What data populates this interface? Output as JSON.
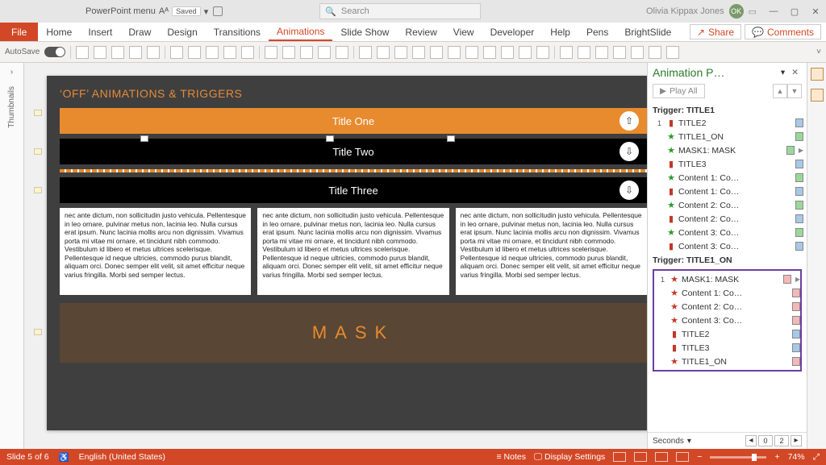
{
  "titlebar": {
    "doc_name": "PowerPoint menu",
    "saved_state": "Saved",
    "search_placeholder": "Search",
    "user_name": "Olivia Kippax Jones",
    "user_initials": "OK"
  },
  "tabs": {
    "file": "File",
    "items": [
      "Home",
      "Insert",
      "Draw",
      "Design",
      "Transitions",
      "Animations",
      "Slide Show",
      "Review",
      "View",
      "Developer",
      "Help",
      "Pens",
      "BrightSlide"
    ],
    "active": "Animations",
    "share": "Share",
    "comments": "Comments"
  },
  "toolbar": {
    "autosave_label": "AutoSave"
  },
  "thumb_label": "Thumbnails",
  "slide": {
    "heading": "‘OFF’ ANIMATIONS & TRIGGERS",
    "bar1": "Title One",
    "bar2": "Title Two",
    "bar3": "Title Three",
    "mask": "MASK",
    "body": "nec ante dictum, non sollicitudin justo vehicula. Pellentesque in leo ornare, pulvinar metus non, lacinia leo. Nulla cursus erat ipsum. Nunc lacinia mollis arcu non dignissim. Vivamus porta mi vitae mi ornare, et tincidunt nibh commodo. Vestibulum id libero et metus ultrices scelerisque. Pellentesque id neque ultricies, commodo purus blandit, aliquam orci. Donec semper elit velit, sit amet efficitur neque varius fringilla. Morbi sed semper lectus."
  },
  "anim": {
    "title": "Animation P…",
    "play": "Play All",
    "trigger1": "Trigger: TITLE1",
    "trigger2": "Trigger: TITLE1_ON",
    "g1": [
      {
        "n": "1",
        "ic": "bar",
        "col": "red",
        "txt": "TITLE2",
        "sw": "blue"
      },
      {
        "n": "",
        "ic": "star",
        "col": "green",
        "txt": "TITLE1_ON",
        "sw": "green"
      },
      {
        "n": "",
        "ic": "star",
        "col": "green",
        "txt": "MASK1: MASK",
        "sw": "green",
        "car": "▶"
      },
      {
        "n": "",
        "ic": "bar",
        "col": "red",
        "txt": "TITLE3",
        "sw": "blue"
      },
      {
        "n": "",
        "ic": "star",
        "col": "green",
        "txt": "Content 1: Co…",
        "sw": "green"
      },
      {
        "n": "",
        "ic": "bar",
        "col": "red",
        "txt": "Content 1: Co…",
        "sw": "blue"
      },
      {
        "n": "",
        "ic": "star",
        "col": "green",
        "txt": "Content 2: Co…",
        "sw": "green"
      },
      {
        "n": "",
        "ic": "bar",
        "col": "red",
        "txt": "Content 2: Co…",
        "sw": "blue"
      },
      {
        "n": "",
        "ic": "star",
        "col": "green",
        "txt": "Content 3: Co…",
        "sw": "green"
      },
      {
        "n": "",
        "ic": "bar",
        "col": "red",
        "txt": "Content 3: Co…",
        "sw": "blue"
      }
    ],
    "g2": [
      {
        "n": "1",
        "ic": "star",
        "col": "red",
        "txt": "MASK1: MASK",
        "sw": "pink",
        "car": "▶"
      },
      {
        "n": "",
        "ic": "star",
        "col": "red",
        "txt": "Content 1: Co…",
        "sw": "pink"
      },
      {
        "n": "",
        "ic": "star",
        "col": "red",
        "txt": "Content 2: Co…",
        "sw": "pink"
      },
      {
        "n": "",
        "ic": "star",
        "col": "red",
        "txt": "Content 3: Co…",
        "sw": "pink"
      },
      {
        "n": "",
        "ic": "bar",
        "col": "red",
        "txt": "TITLE2",
        "sw": "blue"
      },
      {
        "n": "",
        "ic": "bar",
        "col": "red",
        "txt": "TITLE3",
        "sw": "blue"
      },
      {
        "n": "",
        "ic": "star",
        "col": "red",
        "txt": "TITLE1_ON",
        "sw": "pink"
      }
    ],
    "seconds": "Seconds",
    "zoom_vals": [
      "0",
      "2"
    ]
  },
  "status": {
    "slide": "Slide 5 of 6",
    "lang": "English (United States)",
    "notes": "Notes",
    "display": "Display Settings",
    "zoom": "74%"
  }
}
